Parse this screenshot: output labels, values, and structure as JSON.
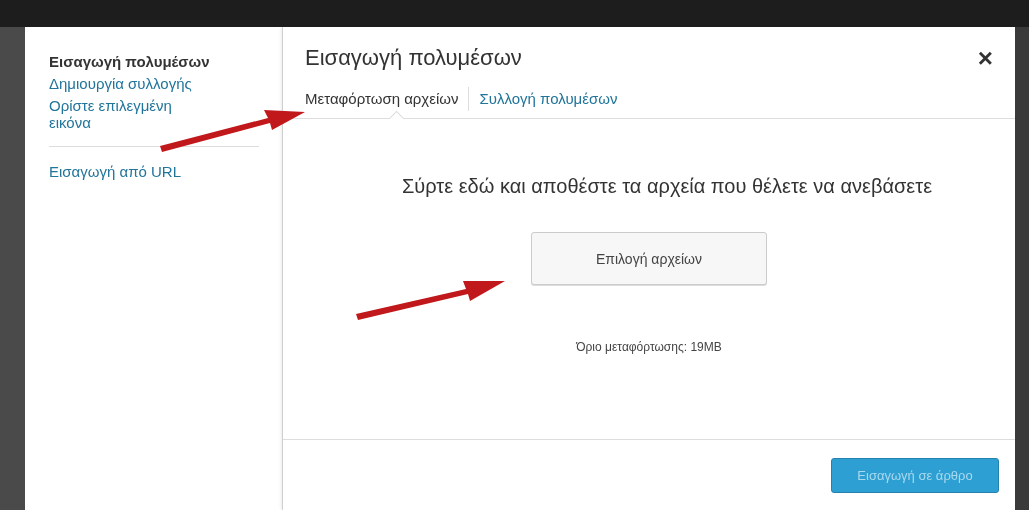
{
  "sidebar": {
    "groups": [
      {
        "items": [
          {
            "label": "Εισαγωγή πολυμέσων",
            "selected": true
          },
          {
            "label": "Δημιουργία συλλογής",
            "selected": false
          },
          {
            "label": "Ορίστε επιλεγμένη εικόνα",
            "selected": false
          }
        ]
      },
      {
        "items": [
          {
            "label": "Εισαγωγή από URL",
            "selected": false
          }
        ]
      }
    ]
  },
  "modal": {
    "title": "Εισαγωγή πολυμέσων",
    "close": "×"
  },
  "tabs": [
    {
      "label": "Μεταφόρτωση αρχείων",
      "selected": true
    },
    {
      "label": "Συλλογή πολυμέσων",
      "selected": false
    }
  ],
  "upload": {
    "instructions": "Σύρτε εδώ και αποθέστε τα αρχεία που θέλετε να ανεβάσετε",
    "button": "Επιλογή αρχείων",
    "limit": "Όριο μεταφόρτωσης: 19MB"
  },
  "footer": {
    "button": "Εισαγωγή σε άρθρο",
    "disabled": true
  }
}
